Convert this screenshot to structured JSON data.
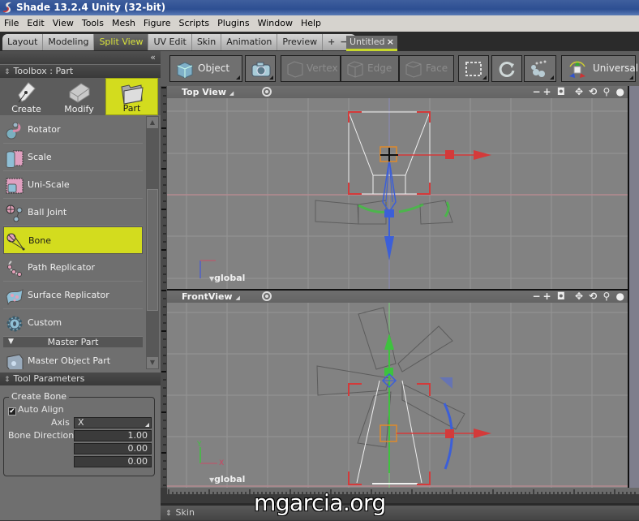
{
  "window": {
    "title": "Shade 13.2.4 Unity (32-bit)"
  },
  "menu": [
    "File",
    "Edit",
    "View",
    "Tools",
    "Mesh",
    "Figure",
    "Scripts",
    "Plugins",
    "Window",
    "Help"
  ],
  "layout_tabs": [
    {
      "label": "Layout",
      "active": false
    },
    {
      "label": "Modeling",
      "active": false
    },
    {
      "label": "Split View",
      "active": true
    },
    {
      "label": "UV Edit",
      "active": false
    },
    {
      "label": "Skin",
      "active": false
    },
    {
      "label": "Animation",
      "active": false
    },
    {
      "label": "Preview",
      "active": false
    }
  ],
  "layout_tab_add": "+",
  "layout_tab_remove": "−",
  "document_tab": {
    "label": "Untitled",
    "close": "×"
  },
  "toolbox": {
    "collapse_icon": "«",
    "header": "Toolbox : Part",
    "modes": [
      {
        "label": "Create",
        "icon": "pen-nib-icon",
        "active": false
      },
      {
        "label": "Modify",
        "icon": "eraser-icon",
        "active": false
      },
      {
        "label": "Part",
        "icon": "folder-icon",
        "active": true
      }
    ],
    "tools": [
      {
        "label": "Rotator",
        "icon": "rotator-icon",
        "active": false
      },
      {
        "label": "Scale",
        "icon": "scale-icon",
        "active": false
      },
      {
        "label": "Uni-Scale",
        "icon": "uni-scale-icon",
        "active": false
      },
      {
        "label": "Ball Joint",
        "icon": "ball-joint-icon",
        "active": false
      },
      {
        "label": "Bone",
        "icon": "bone-icon",
        "active": true
      },
      {
        "label": "Path Replicator",
        "icon": "path-replicator-icon",
        "active": false
      },
      {
        "label": "Surface Replicator",
        "icon": "surface-replicator-icon",
        "active": false
      },
      {
        "label": "Custom",
        "icon": "gear-icon",
        "active": false
      }
    ],
    "section": "Master Part",
    "section_tools": [
      {
        "label": "Master Object Part",
        "icon": "master-object-part-icon"
      }
    ]
  },
  "tool_parameters": {
    "header": "Tool Parameters",
    "group": "Create Bone",
    "auto_align": {
      "label": "Auto Align",
      "checked": true
    },
    "axis": {
      "label": "Axis",
      "value": "X"
    },
    "bone_direction": {
      "label": "Bone Direction",
      "values": [
        "1.00",
        "0.00",
        "0.00"
      ]
    }
  },
  "toolbar": {
    "object": "Object",
    "vertex": "Vertex",
    "edge": "Edge",
    "face": "Face",
    "universal": "Universal"
  },
  "viewports": [
    {
      "title": "Top View",
      "coord_label": "global",
      "tools": [
        "−",
        "+"
      ]
    },
    {
      "title": "FrontView",
      "coord_label": "global",
      "tools": [
        "−",
        "+"
      ]
    }
  ],
  "bottom_panel": {
    "label": "Skin"
  },
  "watermark": "mgarcia.org",
  "colors": {
    "accent": "#d3dc1e",
    "x_axis": "#d43a3a",
    "y_axis": "#3ec23e",
    "z_axis": "#3c5fd8",
    "selection_box": "#e08a2a"
  }
}
